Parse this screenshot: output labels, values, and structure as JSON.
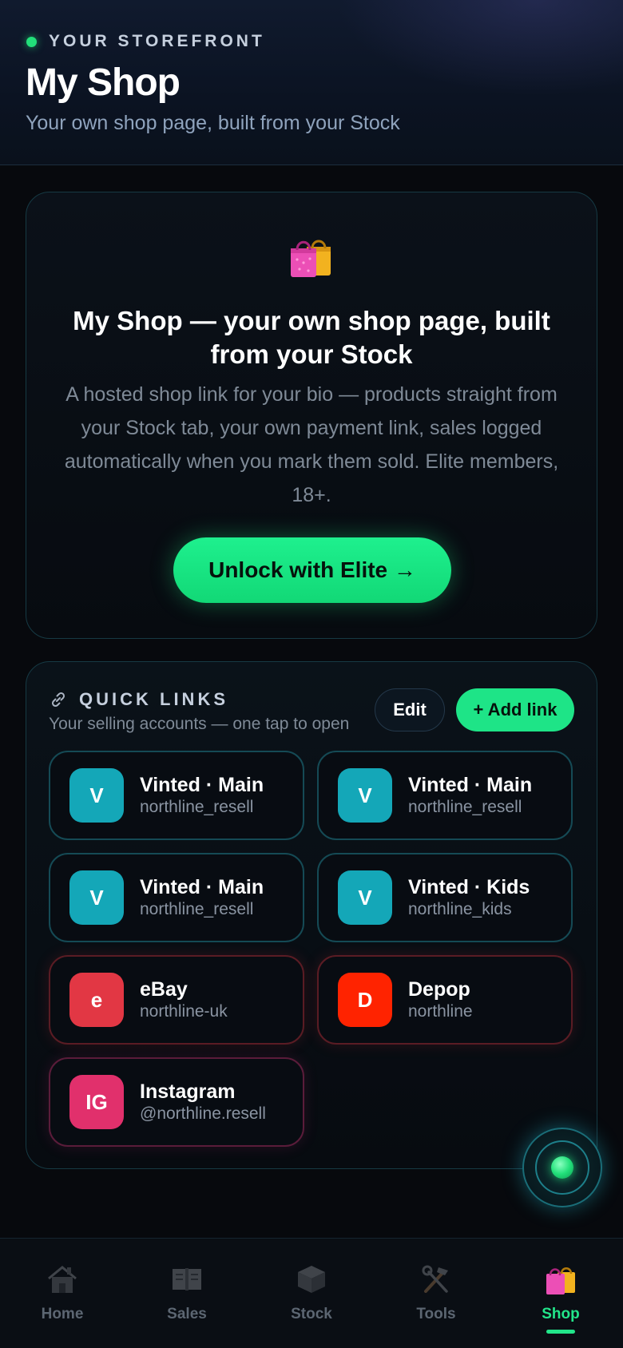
{
  "header": {
    "eyebrow": "YOUR STOREFRONT",
    "title": "My Shop",
    "subtitle": "Your own shop page, built from your Stock"
  },
  "promo": {
    "icon": "shopping-bags-icon",
    "title": "My Shop — your own shop page, built from your Stock",
    "description": "A hosted shop link for your bio — products straight from your Stock tab, your own payment link, sales logged automatically when you mark them sold. Elite members, 18+.",
    "cta_label": "Unlock with Elite →"
  },
  "quick_links": {
    "title": "QUICK LINKS",
    "subtitle": "Your selling accounts — one tap to open",
    "edit_label": "Edit",
    "add_label": "+ Add link",
    "items": [
      {
        "initial": "V",
        "name": "Vinted · Main",
        "handle": "northline_resell",
        "color": "#14a7b8",
        "style": "teal"
      },
      {
        "initial": "V",
        "name": "Vinted · Main",
        "handle": "northline_resell",
        "color": "#14a7b8",
        "style": "teal"
      },
      {
        "initial": "V",
        "name": "Vinted · Main",
        "handle": "northline_resell",
        "color": "#14a7b8",
        "style": "teal"
      },
      {
        "initial": "V",
        "name": "Vinted · Kids",
        "handle": "northline_kids",
        "color": "#14a7b8",
        "style": "teal"
      },
      {
        "initial": "e",
        "name": "eBay",
        "handle": "northline-uk",
        "color": "#e23744",
        "style": "red"
      },
      {
        "initial": "D",
        "name": "Depop",
        "handle": "northline",
        "color": "#ff2300",
        "style": "red"
      },
      {
        "initial": "IG",
        "name": "Instagram",
        "handle": "@northline.resell",
        "color": "#e1306c",
        "style": "pink"
      }
    ]
  },
  "nav": {
    "items": [
      {
        "label": "Home",
        "icon": "house-icon"
      },
      {
        "label": "Sales",
        "icon": "ledger-icon"
      },
      {
        "label": "Stock",
        "icon": "package-icon"
      },
      {
        "label": "Tools",
        "icon": "tools-icon"
      },
      {
        "label": "Shop",
        "icon": "shopping-bags-icon"
      }
    ],
    "active": "Shop"
  },
  "colors": {
    "accent": "#22e58a",
    "background": "#07090d",
    "teal_border": "#154a55"
  }
}
